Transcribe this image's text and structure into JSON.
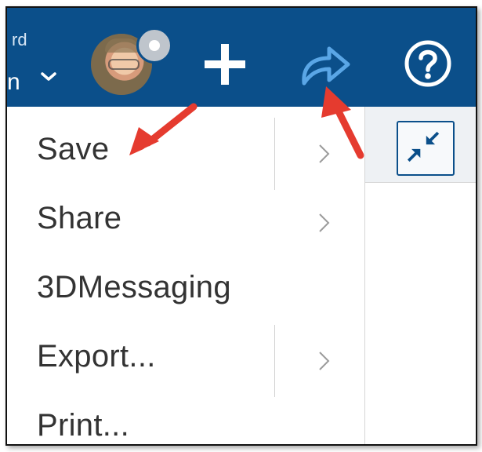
{
  "header": {
    "truncated_top": "rd",
    "truncated_bottom": "n",
    "avatar_alt": "user avatar",
    "icons": [
      "chevron-down-icon",
      "status-badge-icon",
      "plus-icon",
      "share-icon",
      "help-icon"
    ]
  },
  "menu": {
    "items": [
      {
        "label": "Save",
        "has_submenu": true
      },
      {
        "label": "Share",
        "has_submenu": true
      },
      {
        "label": "3DMessaging",
        "has_submenu": false
      },
      {
        "label": "Export...",
        "has_submenu": true
      },
      {
        "label": "Print...",
        "has_submenu": false
      }
    ]
  },
  "colors": {
    "header_bg": "#0b4f8a",
    "share_icon": "#5aa6e6",
    "annotation_arrow": "#e53b2f",
    "text": "#333333"
  }
}
